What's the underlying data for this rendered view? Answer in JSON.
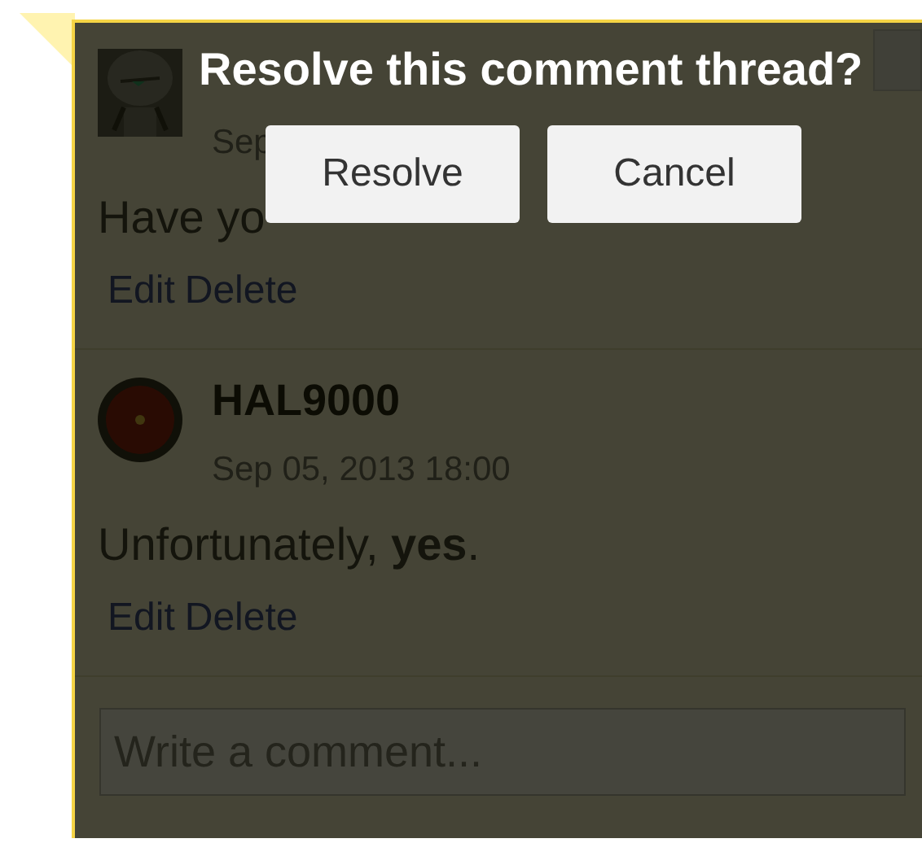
{
  "thread": {
    "comments": [
      {
        "avatar": {
          "kind": "robot"
        },
        "date": "Sep",
        "body": "Have yo",
        "actions": [
          "Edit",
          "Delete"
        ]
      },
      {
        "avatar": {
          "kind": "eye"
        },
        "author": "HAL9000",
        "date": "Sep 05, 2013 18:00",
        "body": "Unfortunately, **yes**.",
        "actions": [
          "Edit",
          "Delete"
        ]
      }
    ],
    "reply": {
      "placeholder": "Write a comment..."
    }
  },
  "dialog": {
    "title": "Resolve this comment thread?",
    "buttons": [
      "Resolve",
      "Cancel"
    ]
  }
}
